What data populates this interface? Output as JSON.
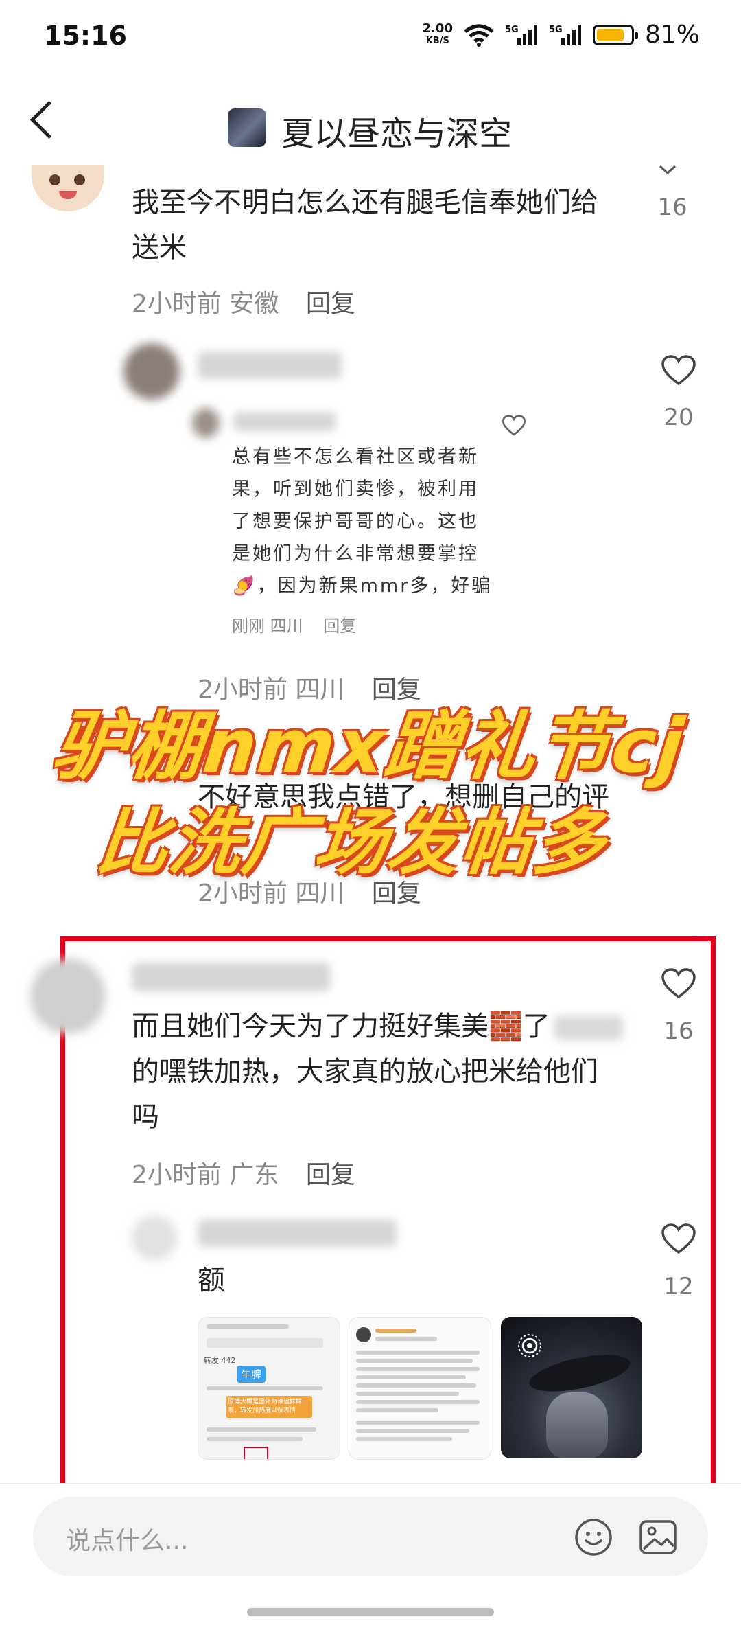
{
  "status_bar": {
    "time": "15:16",
    "net_speed": "2.00",
    "net_unit": "KB/S",
    "signal1": "5G",
    "signal2": "5G",
    "battery": "81%",
    "battery_level": 0.81
  },
  "header": {
    "title": "夏以昼恋与深空",
    "back_icon": "chevron-left-icon"
  },
  "comments": {
    "c1": {
      "text_line1": "我至今不明白怎么还有腿毛信奉她们给",
      "text_line2": "送米",
      "meta_time": "2小时前",
      "meta_location": "安徽",
      "reply": "回复",
      "likes": "16"
    },
    "c2": {
      "likes": "20",
      "quote": {
        "lines": [
          "总有些不怎么看社区或者新",
          "果，听到她们卖惨，被利用",
          "了想要保护哥哥的心。这也",
          "是她们为什么非常想要掌控",
          "🍠，因为新果mmr多，好骗"
        ],
        "meta_time": "刚刚",
        "meta_location": "四川",
        "reply": "回复"
      },
      "meta_time": "2小时前",
      "meta_location": "四川",
      "reply": "回复"
    },
    "c3": {
      "text": "不好意思我点错了，想删自己的评",
      "meta_time": "2小时前",
      "meta_location": "四川",
      "reply": "回复"
    },
    "c4": {
      "text_line1": "而且她们今天为了力挺好集美🧱了",
      "text_line2": "的嘿铁加热，大家真的放心把米给他们",
      "text_line3": "吗",
      "meta_time": "2小时前",
      "meta_location": "广东",
      "reply": "回复",
      "likes": "16"
    },
    "c5": {
      "text": "额",
      "likes": "12",
      "thumb1_tag": "牛脾",
      "thumb1_count": "转发 442",
      "thumb1_note": "原博大概是团外为谁追妹妹啊，转发加热度以保表情"
    }
  },
  "overlay": {
    "line1": "驴棚nmx蹭礼节cj",
    "line2": "比洗广场发帖多"
  },
  "input": {
    "placeholder": "说点什么..."
  }
}
